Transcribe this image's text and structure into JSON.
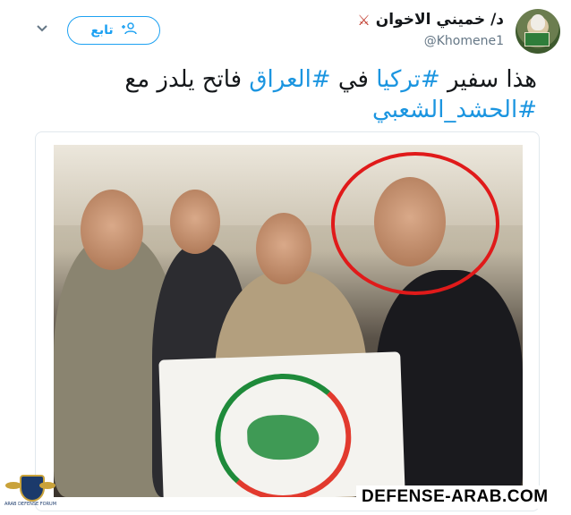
{
  "tweet": {
    "display_name": "د/ خميني الاخوان",
    "handle": "@Khomene1",
    "follow_label": "تابع",
    "text_plain_1": "هذا سفير",
    "hashtag_1": "#تركيا",
    "text_plain_2": "في",
    "hashtag_2": "#العراق",
    "text_plain_3": "فاتح يلدز مع",
    "hashtag_3": "#الحشد_الشعبي"
  },
  "icons": {
    "name_badge": "crossed-swords-icon",
    "follow": "add-user-icon",
    "menu": "chevron-down-icon"
  },
  "watermark": {
    "text": "DEFENSE-ARAB.COM",
    "logo_caption": "ARAB DEFENSE FORUM"
  },
  "colors": {
    "accent": "#1da1f2",
    "hashtag": "#1b95e0",
    "circle": "#e01a1a"
  }
}
